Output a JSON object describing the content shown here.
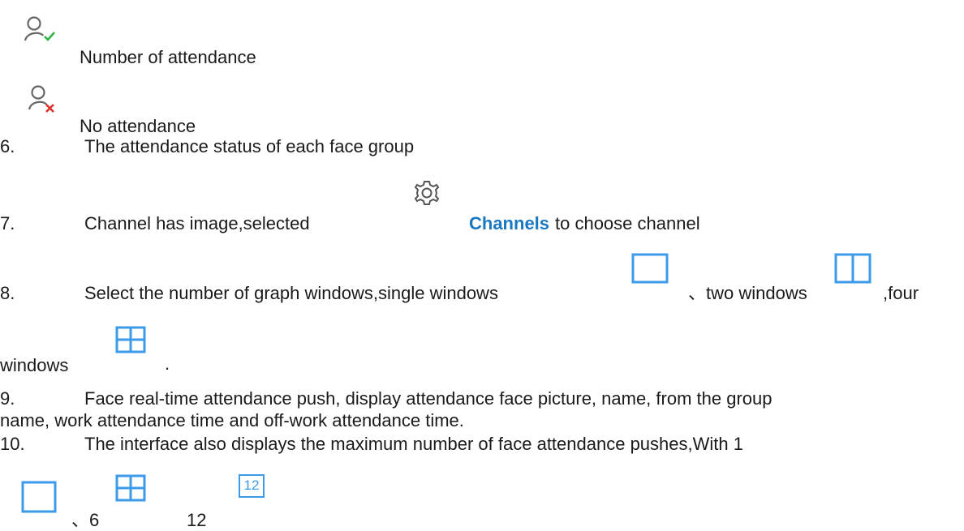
{
  "legend": {
    "attendance_label": "Number of attendance",
    "no_attendance_label": "No attendance",
    "attendance_icon": "user-check-icon",
    "no_attendance_icon": "user-x-icon"
  },
  "items": {
    "item6": {
      "num": "6.",
      "text": "The attendance status of each face group"
    },
    "item7": {
      "num": "7.",
      "text_a": "Channel has image,selected",
      "link": "Channels",
      "text_b": "to choose channel",
      "icon": "gear-icon"
    },
    "item8": {
      "num": "8.",
      "text_a": "Select the number of graph windows,single windows",
      "sep1": "、two windows",
      "text_b": ",four",
      "text_c": "windows",
      "period": ".",
      "icons": [
        "single-window-icon",
        "two-windows-icon",
        "four-windows-icon"
      ]
    },
    "item9": {
      "num": "9.",
      "line1": "Face real-time attendance push, display attendance face picture, name, from the group",
      "line2": "name, work attendance time and off-work attendance time."
    },
    "item10": {
      "num": "10.",
      "line1": "The interface also displays the maximum number of face attendance pushes,With 1",
      "sep_6": "、6",
      "val_12": "12",
      "icon_12_text": "12",
      "icons": [
        "single-window-icon",
        "four-windows-icon",
        "twelve-windows-icon"
      ]
    }
  },
  "colors": {
    "blue": "#1a78c2",
    "icon_blue": "#3b9be8",
    "check_green": "#2fb344",
    "cross_red": "#e0302b",
    "gray_icon": "#666666"
  }
}
